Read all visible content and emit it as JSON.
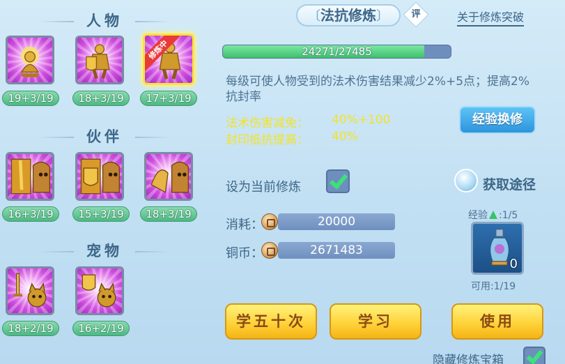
{
  "left": {
    "sections": [
      {
        "title": "人物"
      },
      {
        "title": "伙伴"
      },
      {
        "title": "宠物"
      }
    ],
    "character_items": [
      {
        "level": "19+3/19",
        "name": "magic-resist-idol"
      },
      {
        "level": "18+3/19",
        "name": "defense-idol"
      },
      {
        "level": "17+3/19",
        "name": "magic-defense-idol",
        "badge": "修炼中"
      }
    ],
    "partner_items": [
      {
        "level": "16+3/19"
      },
      {
        "level": "15+3/19"
      },
      {
        "level": "18+3/19"
      }
    ],
    "pet_items": [
      {
        "level": "18+2/19"
      },
      {
        "level": "16+2/19"
      }
    ]
  },
  "right": {
    "title": "法抗修炼",
    "review_badge": "评",
    "about_link": "关于修炼突破",
    "exp_bar": {
      "text": "24271/27485",
      "progress": 0.883
    },
    "description": "每级可使人物受到的法术伤害结果减少2%+5点；提高2%抗封率",
    "effects": [
      {
        "label": "法术伤害减免：",
        "value": "40%+100"
      },
      {
        "label": "封印抵抗提高：",
        "value": "40%"
      }
    ],
    "exchange_button": "经验换修",
    "set_current_label": "设为当前修炼",
    "set_current_checked": true,
    "obtain_label": "获取途径",
    "cost_label": "消耗：",
    "cost_value": "20000",
    "coins_label": "铜币：",
    "coins_value": "2671483",
    "exp_item": {
      "label_prefix": "经验",
      "label_suffix": ":1/5",
      "count": "0",
      "available": "可用:1/19"
    },
    "buttons": {
      "learn50": "学五十次",
      "learn": "学习",
      "use": "使用"
    },
    "hide_box_label": "隐藏修炼宝箱",
    "hide_box_checked": true
  },
  "colors": {
    "accent": "#3d6687",
    "yellow": "#f4e226",
    "green": "#3ee07a"
  }
}
